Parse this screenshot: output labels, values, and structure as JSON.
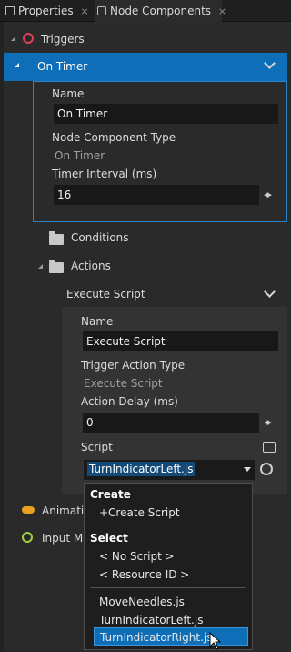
{
  "tabs": [
    {
      "label": "Properties",
      "close": "⨯"
    },
    {
      "label": "Node Components",
      "close": "⨯"
    }
  ],
  "triggers": {
    "label": "Triggers"
  },
  "on_timer": {
    "header": "On Timer",
    "name_label": "Name",
    "name_value": "On Timer",
    "type_label": "Node Component Type",
    "type_value": "On Timer",
    "interval_label": "Timer Interval (ms)",
    "interval_value": "16"
  },
  "conditions": {
    "label": "Conditions"
  },
  "actions": {
    "label": "Actions"
  },
  "execute_script": {
    "header": "Execute Script",
    "name_label": "Name",
    "name_value": "Execute Script",
    "type_label": "Trigger Action Type",
    "type_value": "Execute Script",
    "delay_label": "Action Delay (ms)",
    "delay_value": "0",
    "script_label": "Script",
    "script_value": "TurnIndicatorLeft.js"
  },
  "animations": {
    "label": "Animatio"
  },
  "input_manager": {
    "label": "Input Ma"
  },
  "dropdown": {
    "create_head": "Create",
    "create_item": "+Create Script",
    "select_head": "Select",
    "no_script": "< No Script >",
    "resource_id": "< Resource ID >",
    "scripts": [
      "MoveNeedles.js",
      "TurnIndicatorLeft.js",
      "TurnIndicatorRight.js"
    ],
    "highlighted_index": 2
  },
  "colors": {
    "accent": "#0f6eb8",
    "box_border": "#2b84cb"
  }
}
